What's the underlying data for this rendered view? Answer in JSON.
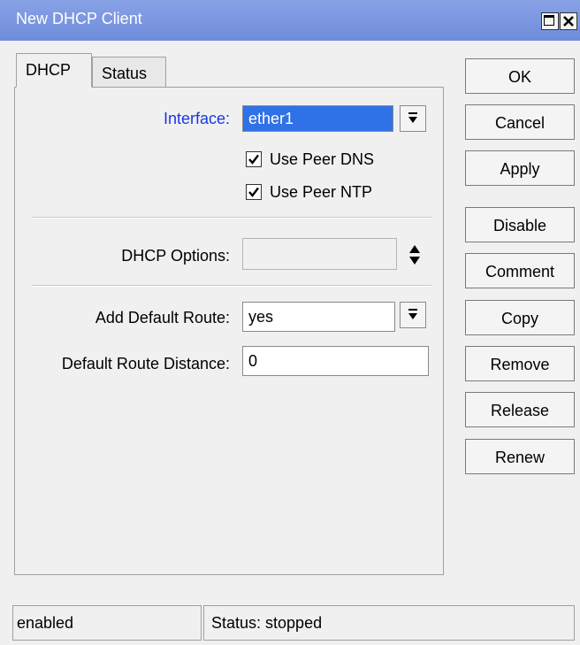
{
  "window": {
    "title": "New DHCP Client"
  },
  "tabs": [
    {
      "label": "DHCP",
      "active": true
    },
    {
      "label": "Status",
      "active": false
    }
  ],
  "form": {
    "interface": {
      "label": "Interface:",
      "value": "ether1"
    },
    "use_peer_dns": {
      "label": "Use Peer DNS",
      "checked": true
    },
    "use_peer_ntp": {
      "label": "Use Peer NTP",
      "checked": true
    },
    "dhcp_options": {
      "label": "DHCP Options:",
      "value": ""
    },
    "add_default_route": {
      "label": "Add Default Route:",
      "value": "yes"
    },
    "default_route_distance": {
      "label": "Default Route Distance:",
      "value": "0"
    }
  },
  "buttons": {
    "ok": "OK",
    "cancel": "Cancel",
    "apply": "Apply",
    "disable": "Disable",
    "comment": "Comment",
    "copy": "Copy",
    "remove": "Remove",
    "release": "Release",
    "renew": "Renew"
  },
  "status": {
    "state": "enabled",
    "status_text": "Status: stopped"
  },
  "colors": {
    "titlebar": "#7a96df",
    "selection": "#2f71e6",
    "interface_label": "#1a37e0"
  },
  "icons": {
    "maximize": "maximize-icon",
    "close": "close-icon",
    "dropdown": "dropdown-arrow-icon",
    "updown": "up-down-arrow-icon",
    "checkmark": "checkmark-icon"
  }
}
